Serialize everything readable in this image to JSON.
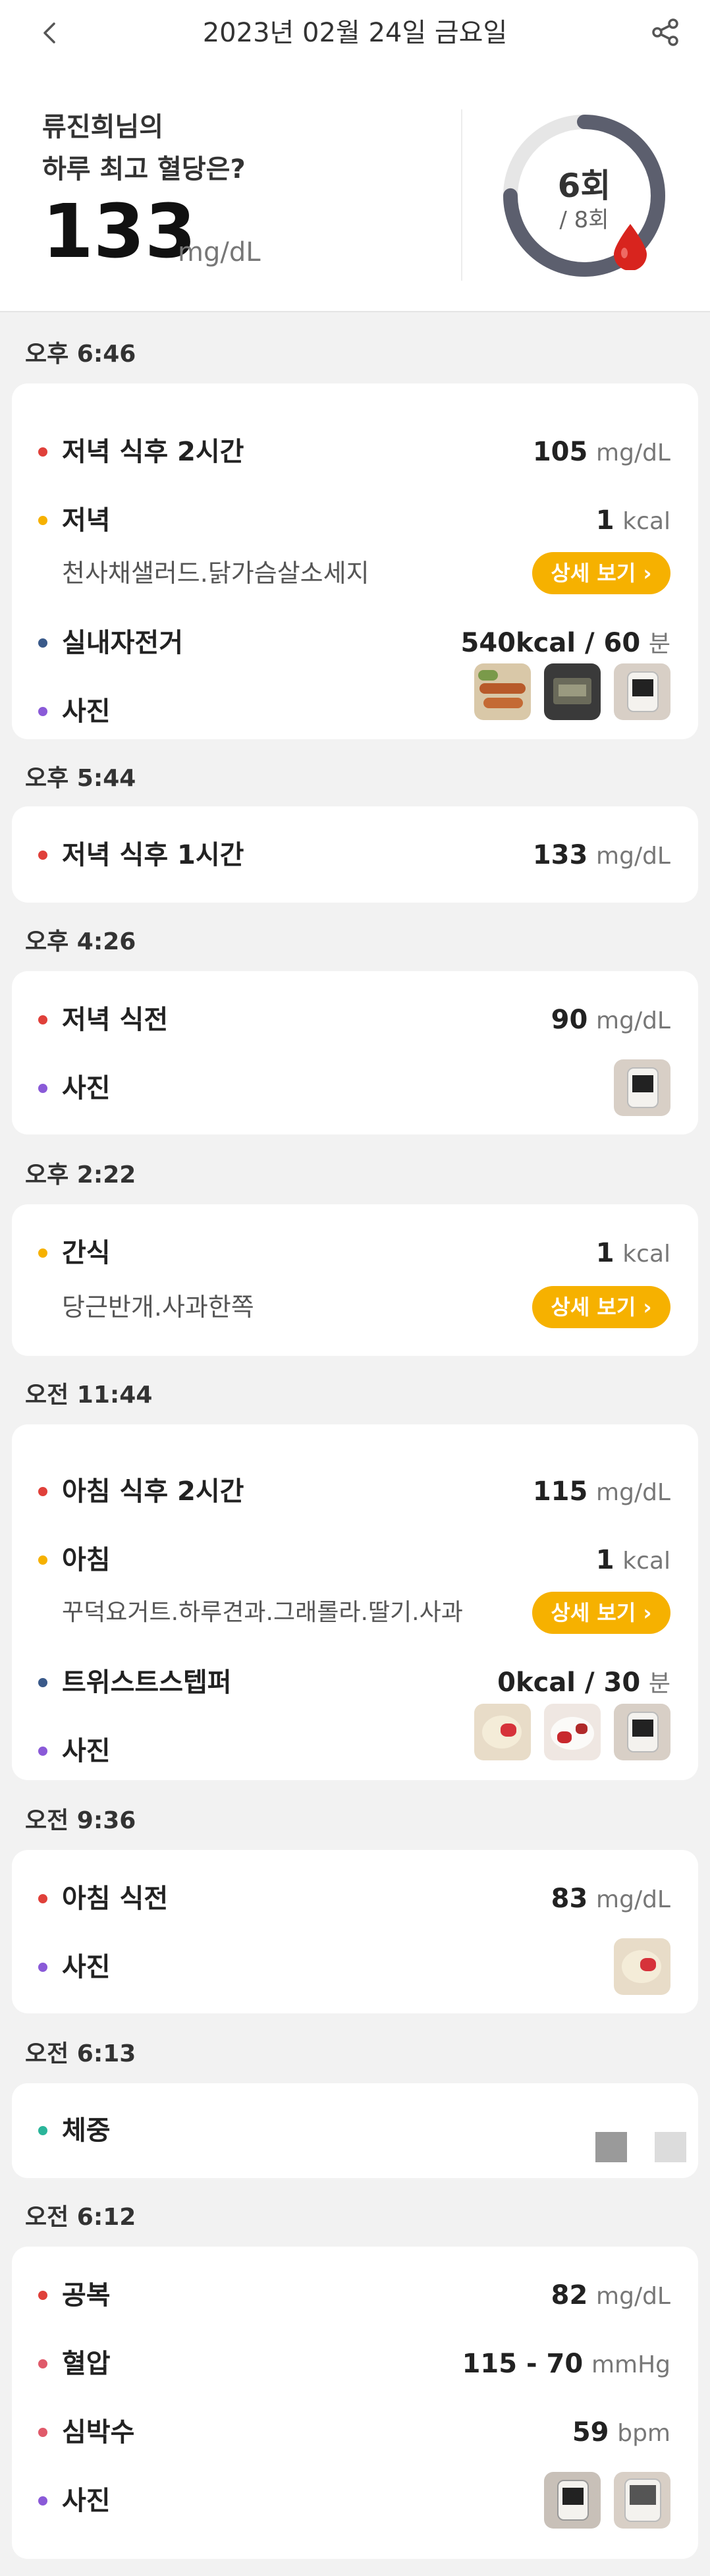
{
  "header": {
    "title": "2023년 02월 24일 금요일"
  },
  "summary": {
    "line1": "류진희님의",
    "line2": "하루 최고 혈당은?",
    "value": "133",
    "unit": "mg/dL",
    "count": "6회",
    "total": "/ 8회",
    "progress": 0.75
  },
  "colors": {
    "glucose": "#e0403a",
    "meal": "#f6b100",
    "exercise": "#3a5a8a",
    "photo": "#8a5ad8",
    "weight": "#2ab59a",
    "heart": "#e05a6a",
    "button": "#f6b100"
  },
  "entries": [
    {
      "time": "오후 6:46",
      "rows": [
        {
          "label": "저녁 식후 2시간",
          "value": "105",
          "unit": "mg/dL"
        },
        {
          "label": "저녁",
          "value": "1",
          "unit": "kcal",
          "sub": "천사채샐러드.닭가슴살소세지",
          "button": "상세 보기"
        },
        {
          "label": "실내자전거",
          "value": "540kcal / 60",
          "unit": "분"
        },
        {
          "label": "사진"
        }
      ]
    },
    {
      "time": "오후 5:44",
      "rows": [
        {
          "label": "저녁 식후 1시간",
          "value": "133",
          "unit": "mg/dL"
        }
      ]
    },
    {
      "time": "오후 4:26",
      "rows": [
        {
          "label": "저녁 식전",
          "value": "90",
          "unit": "mg/dL"
        },
        {
          "label": "사진"
        }
      ]
    },
    {
      "time": "오후 2:22",
      "rows": [
        {
          "label": "간식",
          "value": "1",
          "unit": "kcal",
          "sub": "당근반개.사과한쪽",
          "button": "상세 보기"
        }
      ]
    },
    {
      "time": "오전 11:44",
      "rows": [
        {
          "label": "아침 식후 2시간",
          "value": "115",
          "unit": "mg/dL"
        },
        {
          "label": "아침",
          "value": "1",
          "unit": "kcal",
          "sub": "꾸덕요거트.하루견과.그래롤라.딸기.사과",
          "button": "상세 보기"
        },
        {
          "label": "트위스트스텝퍼",
          "value": "0kcal / 30",
          "unit": "분"
        },
        {
          "label": "사진"
        }
      ]
    },
    {
      "time": "오전 9:36",
      "rows": [
        {
          "label": "아침 식전",
          "value": "83",
          "unit": "mg/dL"
        },
        {
          "label": "사진"
        }
      ]
    },
    {
      "time": "오전 6:13",
      "rows": [
        {
          "label": "체중"
        }
      ]
    },
    {
      "time": "오전 6:12",
      "rows": [
        {
          "label": "공복",
          "value": "82",
          "unit": "mg/dL"
        },
        {
          "label": "혈압",
          "value": "115 - 70",
          "unit": "mmHg"
        },
        {
          "label": "심박수",
          "value": "59",
          "unit": "bpm"
        },
        {
          "label": "사진"
        }
      ]
    }
  ]
}
